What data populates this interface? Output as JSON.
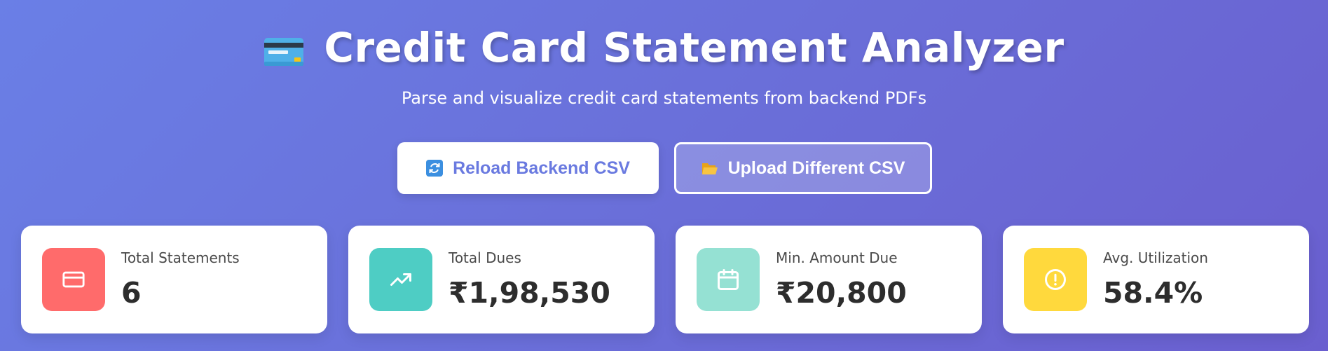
{
  "header": {
    "title": "Credit Card Statement Analyzer",
    "subtitle": "Parse and visualize credit card statements from backend PDFs",
    "title_icon": "credit-card-icon"
  },
  "actions": {
    "reload_label": "Reload Backend CSV",
    "reload_icon": "refresh-icon",
    "upload_label": "Upload Different CSV",
    "upload_icon": "folder-icon"
  },
  "stats": [
    {
      "label": "Total Statements",
      "value": "6",
      "icon": "credit-card-icon",
      "color": "#ff6b6b"
    },
    {
      "label": "Total Dues",
      "value": "₹1,98,530",
      "icon": "trending-up-icon",
      "color": "#4ecdc4"
    },
    {
      "label": "Min. Amount Due",
      "value": "₹20,800",
      "icon": "calendar-icon",
      "color": "#95e1d3"
    },
    {
      "label": "Avg. Utilization",
      "value": "58.4%",
      "icon": "alert-circle-icon",
      "color": "#ffd93d"
    }
  ],
  "colors": {
    "background_start": "#6a7fe6",
    "background_end": "#6a5fcf",
    "reload_text": "#6a7ae0"
  }
}
